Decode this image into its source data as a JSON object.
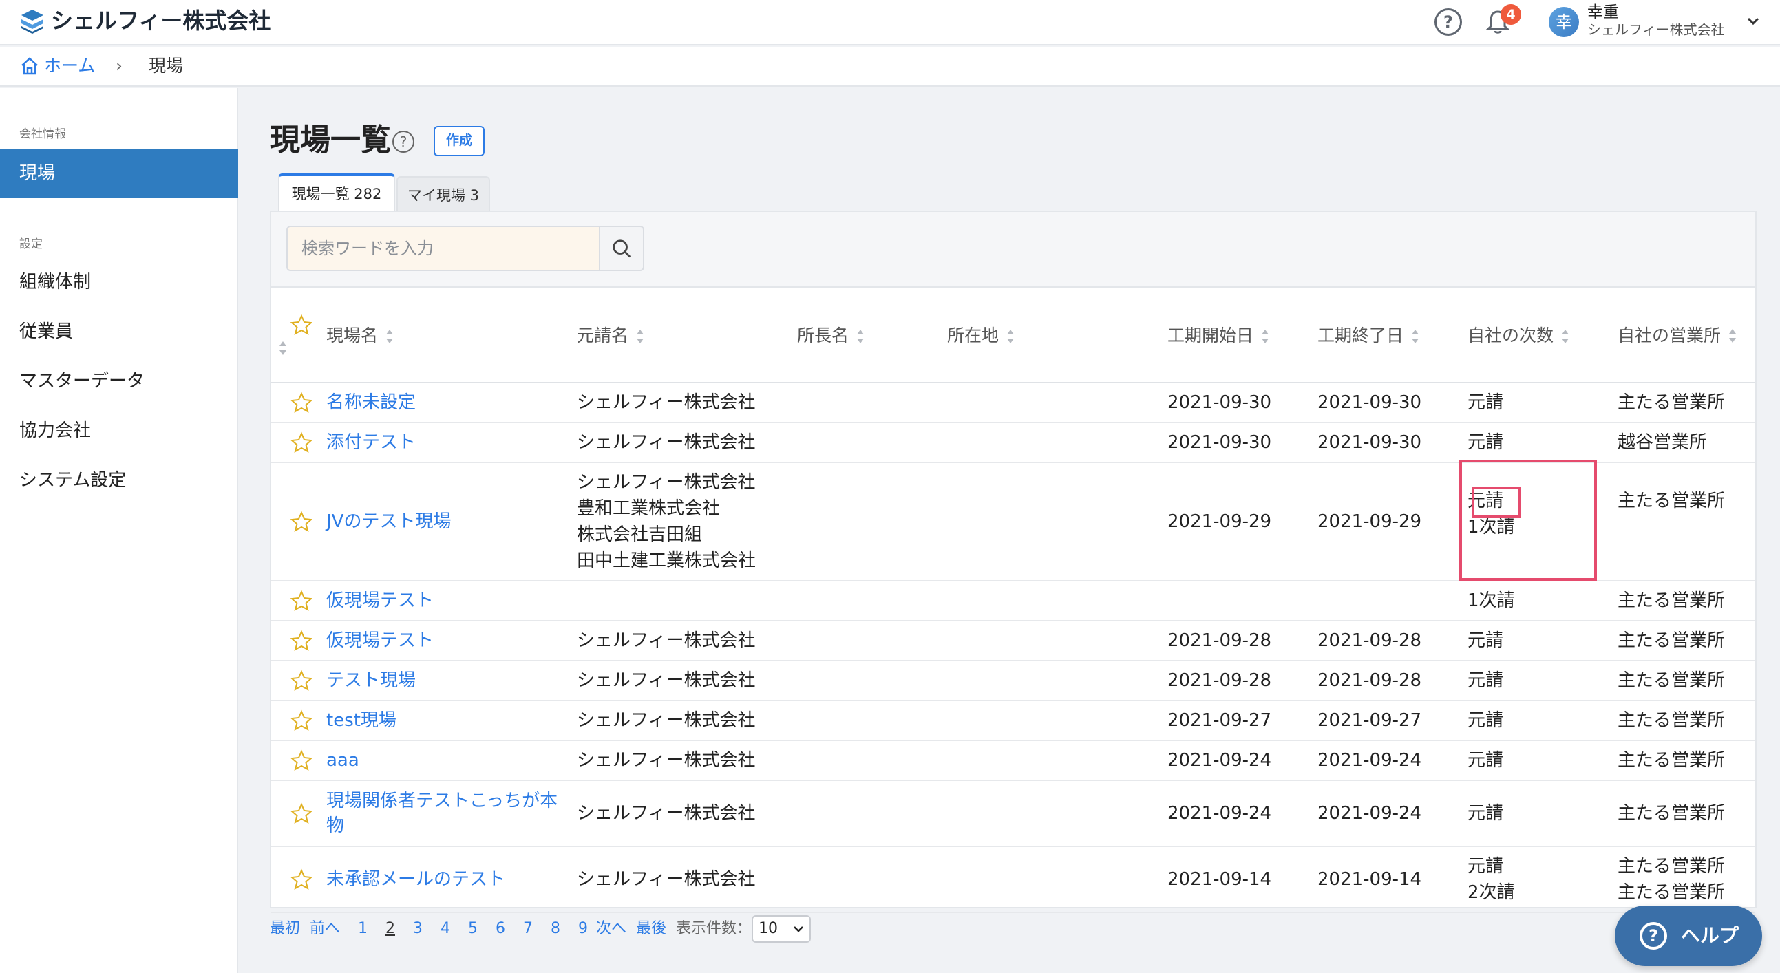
{
  "header": {
    "company": "シェルフィー株式会社",
    "notification_count": "4",
    "user_avatar": "幸",
    "user_name": "幸重",
    "user_company": "シェルフィー株式会社",
    "help_glyph": "?"
  },
  "breadcrumb": {
    "home": "ホーム",
    "separator": "›",
    "current": "現場"
  },
  "sidebar": {
    "section_company": "会社情報",
    "active_item": "現場",
    "section_settings": "設定",
    "items": [
      "組織体制",
      "従業員",
      "マスターデータ",
      "協力会社",
      "システム設定"
    ]
  },
  "main": {
    "title": "現場一覧",
    "create_label": "作成",
    "tabs": [
      {
        "label": "現場一覧 282",
        "active": true
      },
      {
        "label": "マイ現場 3",
        "active": false
      }
    ],
    "search_placeholder": "検索ワードを入力"
  },
  "table": {
    "headers": [
      "現場名",
      "元請名",
      "所長名",
      "所在地",
      "工期開始日",
      "工期終了日",
      "自社の次数",
      "自社の営業所"
    ],
    "rows": [
      {
        "name": "名称未設定",
        "contractor": [
          "シェルフィー株式会社"
        ],
        "manager": "",
        "location": "",
        "start": "2021-09-30",
        "end": "2021-09-30",
        "tier": [
          "元請"
        ],
        "office": [
          "主たる営業所"
        ]
      },
      {
        "name": "添付テスト",
        "contractor": [
          "シェルフィー株式会社"
        ],
        "manager": "",
        "location": "",
        "start": "2021-09-30",
        "end": "2021-09-30",
        "tier": [
          "元請"
        ],
        "office": [
          "越谷営業所"
        ]
      },
      {
        "name": "JVのテスト現場",
        "contractor": [
          "シェルフィー株式会社",
          "豊和工業株式会社",
          "株式会社吉田組",
          "田中土建工業株式会社"
        ],
        "manager": "",
        "location": "",
        "start": "2021-09-29",
        "end": "2021-09-29",
        "tier": [
          "元請",
          "1次請"
        ],
        "office": [
          "主たる営業所"
        ]
      },
      {
        "name": "仮現場テスト",
        "contractor": [],
        "manager": "",
        "location": "",
        "start": "",
        "end": "",
        "tier": [
          "1次請"
        ],
        "office": [
          "主たる営業所"
        ]
      },
      {
        "name": "仮現場テスト",
        "contractor": [
          "シェルフィー株式会社"
        ],
        "manager": "",
        "location": "",
        "start": "2021-09-28",
        "end": "2021-09-28",
        "tier": [
          "元請"
        ],
        "office": [
          "主たる営業所"
        ]
      },
      {
        "name": "テスト現場",
        "contractor": [
          "シェルフィー株式会社"
        ],
        "manager": "",
        "location": "",
        "start": "2021-09-28",
        "end": "2021-09-28",
        "tier": [
          "元請"
        ],
        "office": [
          "主たる営業所"
        ]
      },
      {
        "name": "test現場",
        "contractor": [
          "シェルフィー株式会社"
        ],
        "manager": "",
        "location": "",
        "start": "2021-09-27",
        "end": "2021-09-27",
        "tier": [
          "元請"
        ],
        "office": [
          "主たる営業所"
        ]
      },
      {
        "name": "aaa",
        "contractor": [
          "シェルフィー株式会社"
        ],
        "manager": "",
        "location": "",
        "start": "2021-09-24",
        "end": "2021-09-24",
        "tier": [
          "元請"
        ],
        "office": [
          "主たる営業所"
        ]
      },
      {
        "name": "現場関係者テストこっちが本物",
        "contractor": [
          "シェルフィー株式会社"
        ],
        "manager": "",
        "location": "",
        "start": "2021-09-24",
        "end": "2021-09-24",
        "tier": [
          "元請"
        ],
        "office": [
          "主たる営業所"
        ]
      },
      {
        "name": "未承認メールのテスト",
        "contractor": [
          "シェルフィー株式会社"
        ],
        "manager": "",
        "location": "",
        "start": "2021-09-14",
        "end": "2021-09-14",
        "tier": [
          "元請",
          "2次請"
        ],
        "office": [
          "主たる営業所",
          "主たる営業所"
        ]
      }
    ]
  },
  "pagination": {
    "first": "最初",
    "prev": "前へ",
    "pages": [
      "1",
      "2",
      "3",
      "4",
      "5",
      "6",
      "7",
      "8",
      "9"
    ],
    "current_page": "2",
    "next": "次へ",
    "last": "最後",
    "per_page_label": "表示件数：",
    "per_page_value": "10"
  },
  "help_button": {
    "label": "ヘルプ",
    "glyph": "?"
  },
  "colors": {
    "accent": "#2c7be5",
    "sidebar_active": "#2f7cc0",
    "highlight": "#e54b6d",
    "badge": "#ef5a3c",
    "help_button": "#3a6fa8"
  }
}
